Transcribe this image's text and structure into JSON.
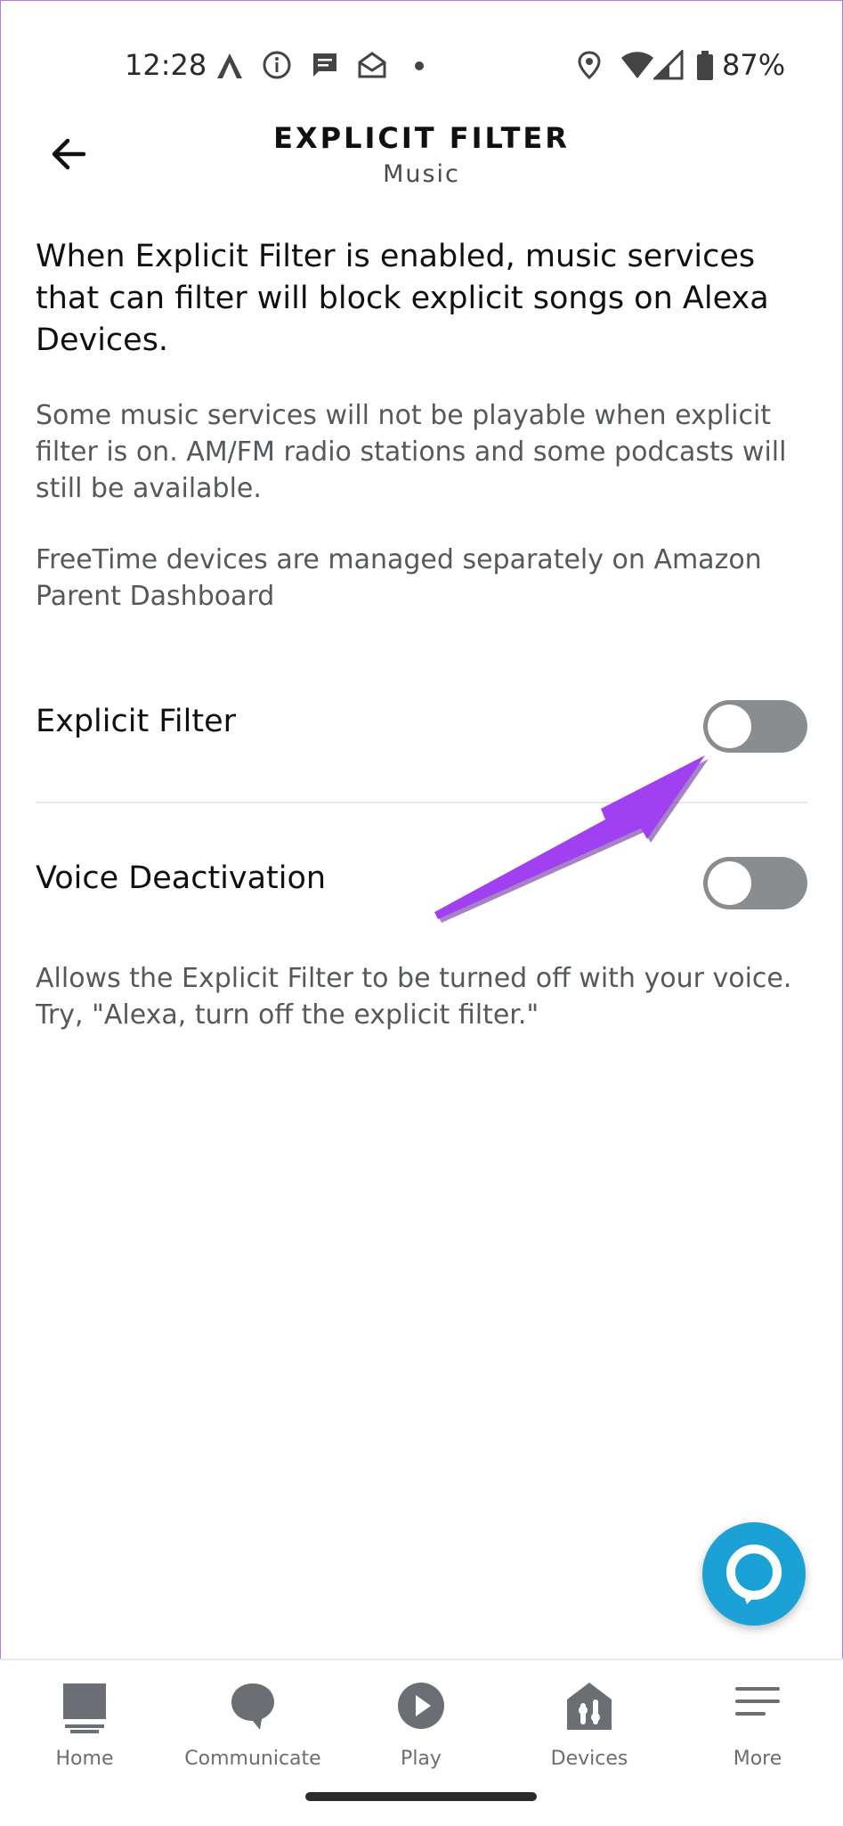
{
  "status_bar": {
    "time": "12:28",
    "battery_percent": "87%",
    "icons": [
      "autodesk-icon",
      "info-icon",
      "message-icon",
      "mail-icon",
      "dot-icon",
      "location-icon",
      "wifi-icon",
      "signal-icon",
      "battery-icon"
    ]
  },
  "header": {
    "title": "EXPLICIT FILTER",
    "subtitle": "Music",
    "back_icon": "back-arrow-icon"
  },
  "content": {
    "intro": "When Explicit Filter is enabled, music services that can filter will block explicit songs on Alexa Devices.",
    "note1": "Some music services will not be playable when explicit filter is on. AM/FM radio stations and some podcasts will still be available.",
    "note2": "FreeTime devices are managed separately on Amazon Parent Dashboard",
    "explicit_filter": {
      "label": "Explicit Filter",
      "on": false
    },
    "voice_deactivation": {
      "label": "Voice Deactivation",
      "on": false,
      "description": "Allows the Explicit Filter to be turned off with your voice. Try, \"Alexa, turn off the explicit filter.\""
    }
  },
  "colors": {
    "accent": "#1ba1d6",
    "toggle_off": "#8a8d8f",
    "annotation_arrow": "#a040f0"
  },
  "nav": {
    "items": [
      {
        "label": "Home",
        "icon": "home-icon"
      },
      {
        "label": "Communicate",
        "icon": "communicate-icon"
      },
      {
        "label": "Play",
        "icon": "play-icon"
      },
      {
        "label": "Devices",
        "icon": "devices-icon"
      },
      {
        "label": "More",
        "icon": "more-icon"
      }
    ]
  }
}
